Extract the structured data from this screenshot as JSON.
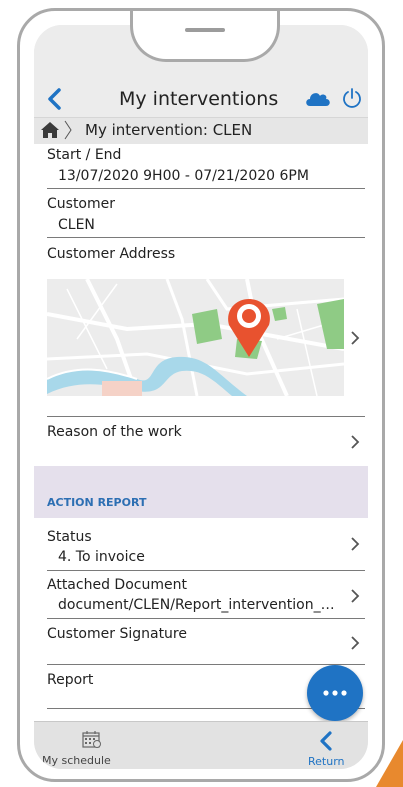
{
  "header": {
    "title": "My interventions"
  },
  "breadcrumb": {
    "text": "My intervention: CLEN"
  },
  "fields": {
    "start_end": {
      "label": "Start / End",
      "value": "13/07/2020 9H00 - 07/21/2020 6PM"
    },
    "customer": {
      "label": "Customer",
      "value": "CLEN"
    },
    "address": {
      "label": "Customer Address"
    },
    "reason": {
      "label": "Reason of the work"
    }
  },
  "action_report": {
    "title": "ACTION REPORT",
    "status": {
      "label": "Status",
      "value": "4. To invoice"
    },
    "attached": {
      "label": "Attached Document",
      "value": "document/CLEN/Report_intervention_…"
    },
    "signature": {
      "label": "Customer Signature"
    },
    "report": {
      "label": "Report"
    }
  },
  "tabbar": {
    "schedule_label": "My schedule",
    "return_label": "Return"
  },
  "colors": {
    "accent": "#1f73c4",
    "section_bg": "#e5e0ec",
    "section_title": "#2d6fb3",
    "map_pin": "#e8522f",
    "corner": "#e8892e"
  },
  "icons": [
    "back-arrow-icon",
    "cloud-icon",
    "power-icon",
    "home-icon",
    "chevron-right-icon",
    "map-pin-icon",
    "more-dots-icon",
    "calendar-icon",
    "return-arrow-icon"
  ]
}
